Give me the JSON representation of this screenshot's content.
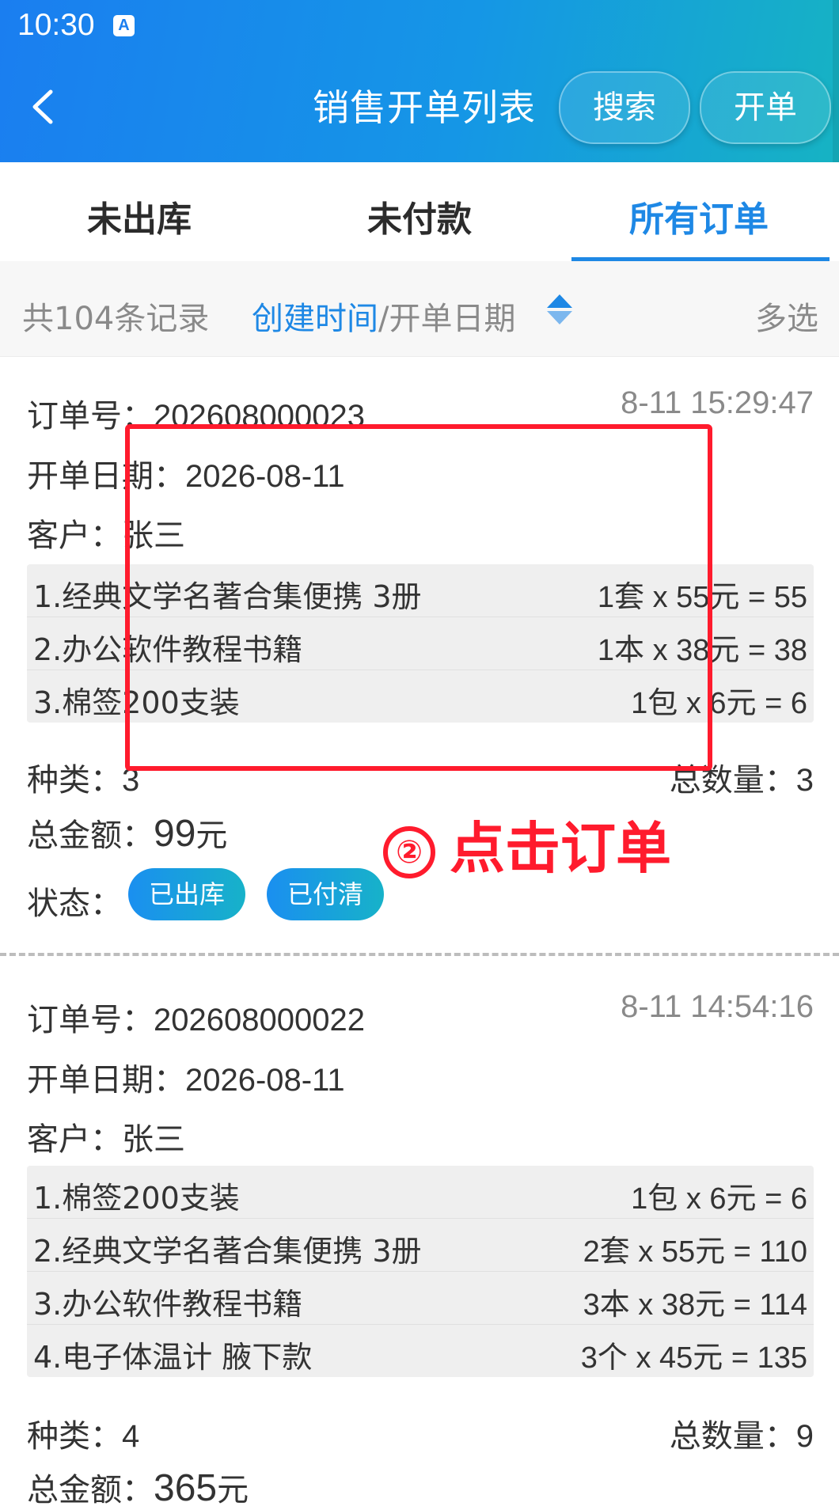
{
  "status_bar": {
    "time": "10:30",
    "icon": "A"
  },
  "header": {
    "title": "销售开单列表",
    "search_label": "搜索",
    "open_label": "开单"
  },
  "tabs": [
    {
      "label": "未出库"
    },
    {
      "label": "未付款"
    },
    {
      "label": "所有订单",
      "active": true
    }
  ],
  "filter": {
    "record_count": "共104条记录",
    "sort_active": "创建时间",
    "sort_separator": "/",
    "sort_alt": "开单日期",
    "multi_select": "多选"
  },
  "labels": {
    "order_no": "订单号：",
    "open_date": "开单日期：",
    "customer": "客户：",
    "kinds": "种类：",
    "total_qty": "总数量：",
    "total_amount": "总金额：",
    "status": "状态："
  },
  "orders": [
    {
      "order_no": "202608000023",
      "time": "8-11 15:29:47",
      "open_date": "2026-08-11",
      "customer": "张三",
      "items": [
        {
          "name": "1.经典文学名著合集便携 3册",
          "calc": "1套 x 55元 = 55"
        },
        {
          "name": "2.办公软件教程书籍",
          "calc": "1本 x 38元 = 38"
        },
        {
          "name": "3.棉签200支装",
          "calc": "1包 x 6元 = 6"
        }
      ],
      "kinds": "3",
      "total_qty": "3",
      "total_amount": "99",
      "amount_unit": "元",
      "statuses": [
        "已出库",
        "已付清"
      ]
    },
    {
      "order_no": "202608000022",
      "time": "8-11 14:54:16",
      "open_date": "2026-08-11",
      "customer": "张三",
      "items": [
        {
          "name": "1.棉签200支装",
          "calc": "1包 x 6元 = 6"
        },
        {
          "name": "2.经典文学名著合集便携 3册",
          "calc": "2套 x 55元 = 110"
        },
        {
          "name": "3.办公软件教程书籍",
          "calc": "3本 x 38元 = 114"
        },
        {
          "name": "4.电子体温计 腋下款",
          "calc": "3个 x 45元 = 135"
        }
      ],
      "kinds": "4",
      "total_qty": "9",
      "total_amount": "365",
      "amount_unit": "元"
    }
  ],
  "annotation": {
    "circle": "②",
    "text": "点击订单"
  },
  "colors": {
    "accent": "#1e88e5",
    "annotation": "#ff1b2d"
  }
}
